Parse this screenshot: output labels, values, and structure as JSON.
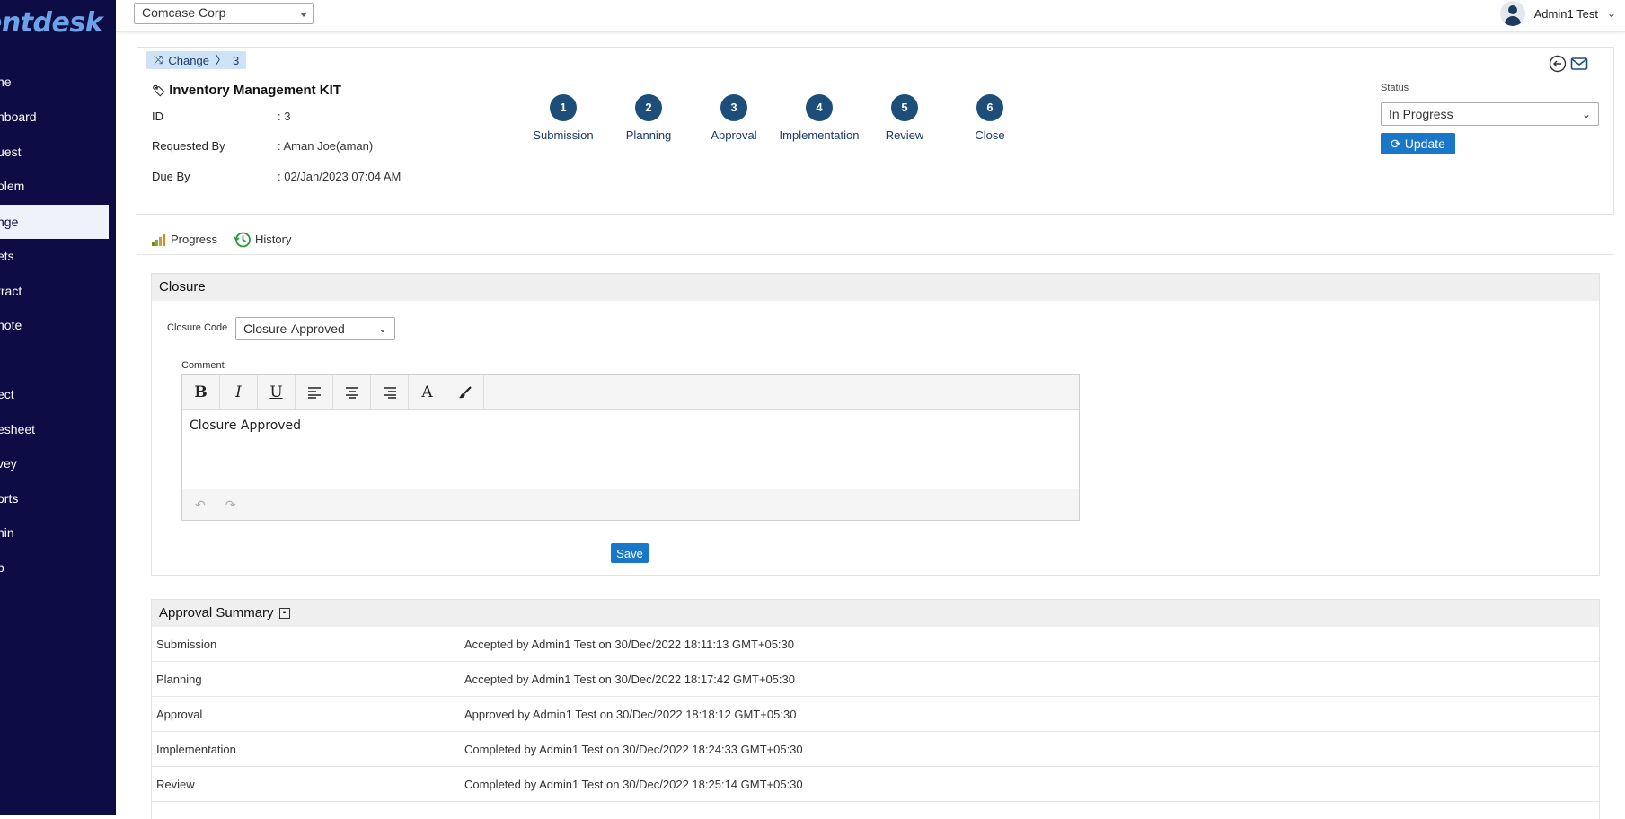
{
  "sidebar": {
    "logo": "entdesk",
    "items": [
      {
        "label": "ne",
        "active": false
      },
      {
        "label": "hboard",
        "active": false
      },
      {
        "label": "uest",
        "active": false
      },
      {
        "label": "olem",
        "active": false
      },
      {
        "label": "nge",
        "active": true
      },
      {
        "label": "ets",
        "active": false
      },
      {
        "label": "tract",
        "active": false
      },
      {
        "label": "note",
        "active": false
      },
      {
        "label": "ect",
        "active": false
      },
      {
        "label": "esheet",
        "active": false
      },
      {
        "label": "vey",
        "active": false
      },
      {
        "label": "orts",
        "active": false
      },
      {
        "label": "nin",
        "active": false
      },
      {
        "label": "p",
        "active": false
      }
    ],
    "bg_color": "#0e0c45"
  },
  "topbar": {
    "org_select": "Comcase Corp",
    "user_name": "Admin1 Test"
  },
  "ticket": {
    "breadcrumb_module": "Change",
    "breadcrumb_id": "3",
    "title": "Inventory Management KIT",
    "fields": {
      "id_label": "ID",
      "id_value": ": 3",
      "requested_by_label": "Requested By",
      "requested_by_value": ": Aman Joe(aman)",
      "due_by_label": "Due By",
      "due_by_value": ": 02/Jan/2023 07:04 AM"
    },
    "steps": [
      {
        "num": "1",
        "label": "Submission"
      },
      {
        "num": "2",
        "label": "Planning"
      },
      {
        "num": "3",
        "label": "Approval"
      },
      {
        "num": "4",
        "label": "Implementation"
      },
      {
        "num": "5",
        "label": "Review"
      },
      {
        "num": "6",
        "label": "Close"
      }
    ],
    "status_label": "Status",
    "status_value": "In Progress",
    "update_label": "Update"
  },
  "tabs": {
    "progress": "Progress",
    "history": "History"
  },
  "closure": {
    "heading": "Closure",
    "code_label": "Closure Code",
    "code_value": "Closure-Approved",
    "comment_label": "Comment",
    "comment_text": "Closure Approved",
    "toolbar": {
      "bold": "B",
      "italic": "I",
      "underline": "U",
      "font": "A"
    },
    "save_label": "Save"
  },
  "approval_summary": {
    "heading": "Approval Summary",
    "rows": [
      {
        "stage": "Submission",
        "detail": "Accepted by Admin1 Test on 30/Dec/2022 18:11:13 GMT+05:30"
      },
      {
        "stage": "Planning",
        "detail": "Accepted by Admin1 Test on 30/Dec/2022 18:17:42 GMT+05:30"
      },
      {
        "stage": "Approval",
        "detail": "Approved by Admin1 Test on 30/Dec/2022 18:18:12 GMT+05:30"
      },
      {
        "stage": "Implementation",
        "detail": "Completed by Admin1 Test on 30/Dec/2022 18:24:33 GMT+05:30"
      },
      {
        "stage": "Review",
        "detail": "Completed by Admin1 Test on 30/Dec/2022 18:25:14 GMT+05:30"
      }
    ]
  },
  "colors": {
    "accent": "#1877c9",
    "step_circle": "#1d4e7a",
    "breadcrumb_bg": "#cfe3f7"
  }
}
